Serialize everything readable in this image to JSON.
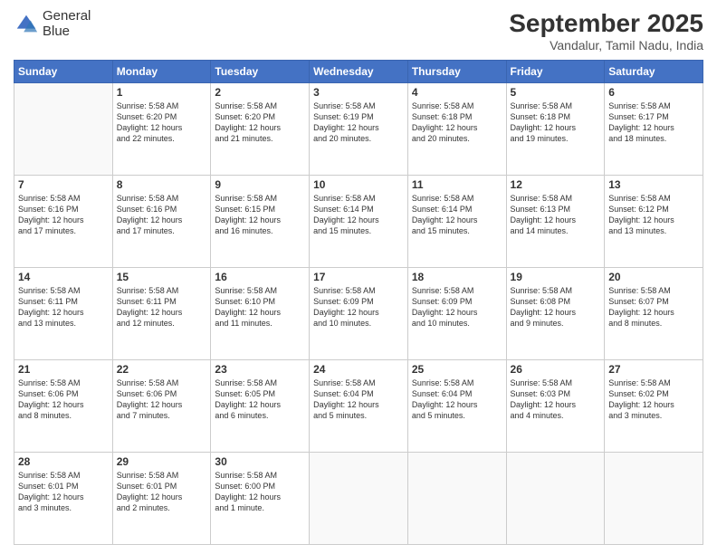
{
  "logo": {
    "line1": "General",
    "line2": "Blue"
  },
  "title": "September 2025",
  "location": "Vandalur, Tamil Nadu, India",
  "days_header": [
    "Sunday",
    "Monday",
    "Tuesday",
    "Wednesday",
    "Thursday",
    "Friday",
    "Saturday"
  ],
  "weeks": [
    [
      {
        "day": "",
        "info": ""
      },
      {
        "day": "1",
        "info": "Sunrise: 5:58 AM\nSunset: 6:20 PM\nDaylight: 12 hours\nand 22 minutes."
      },
      {
        "day": "2",
        "info": "Sunrise: 5:58 AM\nSunset: 6:20 PM\nDaylight: 12 hours\nand 21 minutes."
      },
      {
        "day": "3",
        "info": "Sunrise: 5:58 AM\nSunset: 6:19 PM\nDaylight: 12 hours\nand 20 minutes."
      },
      {
        "day": "4",
        "info": "Sunrise: 5:58 AM\nSunset: 6:18 PM\nDaylight: 12 hours\nand 20 minutes."
      },
      {
        "day": "5",
        "info": "Sunrise: 5:58 AM\nSunset: 6:18 PM\nDaylight: 12 hours\nand 19 minutes."
      },
      {
        "day": "6",
        "info": "Sunrise: 5:58 AM\nSunset: 6:17 PM\nDaylight: 12 hours\nand 18 minutes."
      }
    ],
    [
      {
        "day": "7",
        "info": "Sunrise: 5:58 AM\nSunset: 6:16 PM\nDaylight: 12 hours\nand 17 minutes."
      },
      {
        "day": "8",
        "info": "Sunrise: 5:58 AM\nSunset: 6:16 PM\nDaylight: 12 hours\nand 17 minutes."
      },
      {
        "day": "9",
        "info": "Sunrise: 5:58 AM\nSunset: 6:15 PM\nDaylight: 12 hours\nand 16 minutes."
      },
      {
        "day": "10",
        "info": "Sunrise: 5:58 AM\nSunset: 6:14 PM\nDaylight: 12 hours\nand 15 minutes."
      },
      {
        "day": "11",
        "info": "Sunrise: 5:58 AM\nSunset: 6:14 PM\nDaylight: 12 hours\nand 15 minutes."
      },
      {
        "day": "12",
        "info": "Sunrise: 5:58 AM\nSunset: 6:13 PM\nDaylight: 12 hours\nand 14 minutes."
      },
      {
        "day": "13",
        "info": "Sunrise: 5:58 AM\nSunset: 6:12 PM\nDaylight: 12 hours\nand 13 minutes."
      }
    ],
    [
      {
        "day": "14",
        "info": "Sunrise: 5:58 AM\nSunset: 6:11 PM\nDaylight: 12 hours\nand 13 minutes."
      },
      {
        "day": "15",
        "info": "Sunrise: 5:58 AM\nSunset: 6:11 PM\nDaylight: 12 hours\nand 12 minutes."
      },
      {
        "day": "16",
        "info": "Sunrise: 5:58 AM\nSunset: 6:10 PM\nDaylight: 12 hours\nand 11 minutes."
      },
      {
        "day": "17",
        "info": "Sunrise: 5:58 AM\nSunset: 6:09 PM\nDaylight: 12 hours\nand 10 minutes."
      },
      {
        "day": "18",
        "info": "Sunrise: 5:58 AM\nSunset: 6:09 PM\nDaylight: 12 hours\nand 10 minutes."
      },
      {
        "day": "19",
        "info": "Sunrise: 5:58 AM\nSunset: 6:08 PM\nDaylight: 12 hours\nand 9 minutes."
      },
      {
        "day": "20",
        "info": "Sunrise: 5:58 AM\nSunset: 6:07 PM\nDaylight: 12 hours\nand 8 minutes."
      }
    ],
    [
      {
        "day": "21",
        "info": "Sunrise: 5:58 AM\nSunset: 6:06 PM\nDaylight: 12 hours\nand 8 minutes."
      },
      {
        "day": "22",
        "info": "Sunrise: 5:58 AM\nSunset: 6:06 PM\nDaylight: 12 hours\nand 7 minutes."
      },
      {
        "day": "23",
        "info": "Sunrise: 5:58 AM\nSunset: 6:05 PM\nDaylight: 12 hours\nand 6 minutes."
      },
      {
        "day": "24",
        "info": "Sunrise: 5:58 AM\nSunset: 6:04 PM\nDaylight: 12 hours\nand 5 minutes."
      },
      {
        "day": "25",
        "info": "Sunrise: 5:58 AM\nSunset: 6:04 PM\nDaylight: 12 hours\nand 5 minutes."
      },
      {
        "day": "26",
        "info": "Sunrise: 5:58 AM\nSunset: 6:03 PM\nDaylight: 12 hours\nand 4 minutes."
      },
      {
        "day": "27",
        "info": "Sunrise: 5:58 AM\nSunset: 6:02 PM\nDaylight: 12 hours\nand 3 minutes."
      }
    ],
    [
      {
        "day": "28",
        "info": "Sunrise: 5:58 AM\nSunset: 6:01 PM\nDaylight: 12 hours\nand 3 minutes."
      },
      {
        "day": "29",
        "info": "Sunrise: 5:58 AM\nSunset: 6:01 PM\nDaylight: 12 hours\nand 2 minutes."
      },
      {
        "day": "30",
        "info": "Sunrise: 5:58 AM\nSunset: 6:00 PM\nDaylight: 12 hours\nand 1 minute."
      },
      {
        "day": "",
        "info": ""
      },
      {
        "day": "",
        "info": ""
      },
      {
        "day": "",
        "info": ""
      },
      {
        "day": "",
        "info": ""
      }
    ]
  ]
}
